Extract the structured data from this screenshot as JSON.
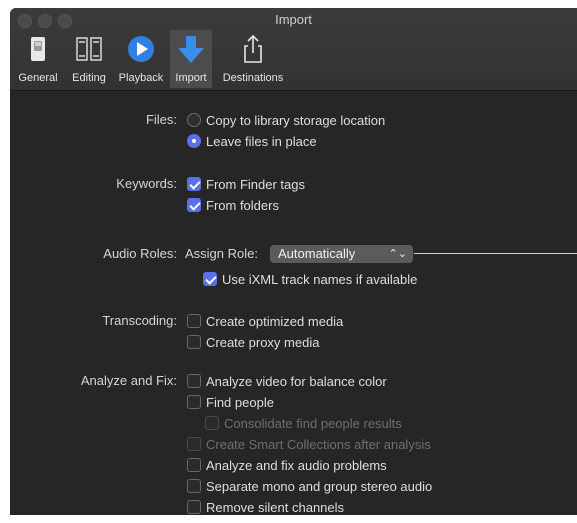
{
  "window": {
    "title": "Import"
  },
  "toolbar": {
    "items": [
      {
        "label": "General",
        "icon": "switch-icon"
      },
      {
        "label": "Editing",
        "icon": "film-strip-icon"
      },
      {
        "label": "Playback",
        "icon": "play-icon"
      },
      {
        "label": "Import",
        "icon": "import-arrow-icon",
        "active": true
      },
      {
        "label": "Destinations",
        "icon": "share-icon"
      }
    ]
  },
  "files": {
    "label": "Files:",
    "options": [
      {
        "label": "Copy to library storage location",
        "selected": false
      },
      {
        "label": "Leave files in place",
        "selected": true
      }
    ]
  },
  "keywords": {
    "label": "Keywords:",
    "options": [
      {
        "label": "From Finder tags",
        "checked": true
      },
      {
        "label": "From folders",
        "checked": true
      }
    ]
  },
  "audio_roles": {
    "label": "Audio Roles:",
    "assign_label": "Assign Role:",
    "popup_value": "Automatically",
    "ixml": {
      "label": "Use iXML track names if available",
      "checked": true
    }
  },
  "transcoding": {
    "label": "Transcoding:",
    "options": [
      {
        "label": "Create optimized media",
        "checked": false
      },
      {
        "label": "Create proxy media",
        "checked": false
      }
    ]
  },
  "analyze": {
    "label": "Analyze and Fix:",
    "options": [
      {
        "label": "Analyze video for balance color",
        "checked": false
      },
      {
        "label": "Find people",
        "checked": false
      },
      {
        "label": "Consolidate find people results",
        "checked": false,
        "disabled": true
      },
      {
        "label": "Create Smart Collections after analysis",
        "checked": false,
        "disabled": true
      },
      {
        "label": "Analyze and fix audio problems",
        "checked": false
      },
      {
        "label": "Separate mono and group stereo audio",
        "checked": false
      },
      {
        "label": "Remove silent channels",
        "checked": false
      }
    ]
  },
  "colors": {
    "accent": "#5a6fe8",
    "background": "#262626"
  }
}
